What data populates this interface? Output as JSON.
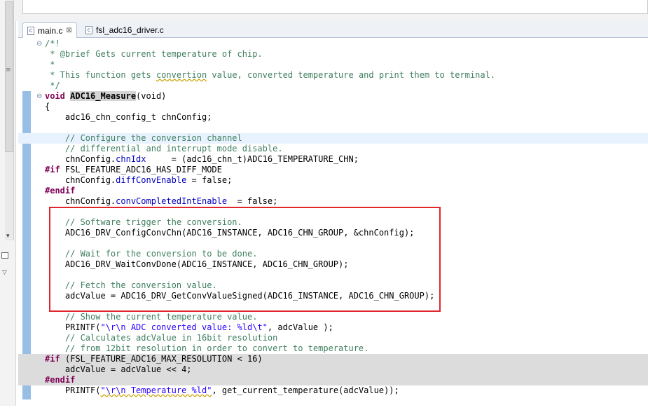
{
  "tabs": [
    {
      "label": "main.c",
      "close": "⊠"
    },
    {
      "label": "fsl_adc16_driver.c"
    }
  ],
  "code_lines": {
    "l01": "/*!",
    "l02": " * @brief Gets current temperature of chip.",
    "l03": " *",
    "l04a": " * This function gets ",
    "l04b": "convertion",
    "l04c": " value, converted temperature and print them to terminal.",
    "l05": " */",
    "l06_kw": "void",
    "l06_fn": "ADC16_Measure",
    "l06_rest": "(void)",
    "l07": "{",
    "l08": "    adc16_chn_config_t chnConfig;",
    "l10": "    // Configure the conversion channel",
    "l11": "    // differential and interrupt mode disable.",
    "l12a": "    chnConfig.",
    "l12b": "chnIdx",
    "l12c": "     = (adc16_chn_t)ADC16_TEMPERATURE_CHN;",
    "l13a": "#if",
    "l13b": " FSL_FEATURE_ADC16_HAS_DIFF_MODE",
    "l14a": "    chnConfig.",
    "l14b": "diffConvEnable",
    "l14c": " = false;",
    "l15": "#endif",
    "l16a": "    chnConfig.",
    "l16b": "convCompletedIntEnable",
    "l16c": "  = false;",
    "l18": "    // Software trigger the conversion.",
    "l19": "    ADC16_DRV_ConfigConvChn(ADC16_INSTANCE, ADC16_CHN_GROUP, &chnConfig);",
    "l21": "    // Wait for the conversion to be done.",
    "l22": "    ADC16_DRV_WaitConvDone(ADC16_INSTANCE, ADC16_CHN_GROUP);",
    "l24": "    // Fetch the conversion value.",
    "l25": "    adcValue = ADC16_DRV_GetConvValueSigned(ADC16_INSTANCE, ADC16_CHN_GROUP);",
    "l27": "    // Show the current temperature value.",
    "l28a": "    PRINTF(",
    "l28b": "\"\\r\\n ADC converted value: %ld\\t\"",
    "l28c": ", adcValue );",
    "l29": "    // Calculates adcValue in 16bit resolution",
    "l30": "    // from 12bit resolution in order to convert to temperature.",
    "l31a": "#if",
    "l31b": " (FSL_FEATURE_ADC16_MAX_RESOLUTION < 16)",
    "l32": "    adcValue = adcValue << 4;",
    "l33": "#endif",
    "l34a": "    PRINTF(",
    "l34b": "\"\\r\\n Temperature %ld\"",
    "l34c": ", get_current_temperature(adcValue));"
  },
  "colors": {
    "comment": "#3f7f5f",
    "keyword": "#7f0055",
    "field": "#0000c0",
    "string": "#2a00ff",
    "highlight_box": "#e0262b"
  }
}
